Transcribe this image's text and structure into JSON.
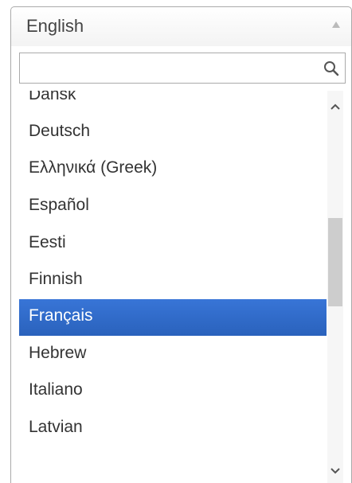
{
  "select": {
    "selected_value": "English"
  },
  "search": {
    "value": "",
    "placeholder": ""
  },
  "options": [
    {
      "label": "Dansk",
      "highlighted": false
    },
    {
      "label": "Deutsch",
      "highlighted": false
    },
    {
      "label": "Ελληνικά (Greek)",
      "highlighted": false
    },
    {
      "label": "Español",
      "highlighted": false
    },
    {
      "label": "Eesti",
      "highlighted": false
    },
    {
      "label": "Finnish",
      "highlighted": false
    },
    {
      "label": "Français",
      "highlighted": true
    },
    {
      "label": "Hebrew",
      "highlighted": false
    },
    {
      "label": "Italiano",
      "highlighted": false
    },
    {
      "label": "Latvian",
      "highlighted": false
    }
  ],
  "colors": {
    "highlight": "#3875d7",
    "border": "#aaaaaa",
    "scroll_thumb": "#cdcdcd"
  },
  "icons": {
    "search": "search-icon",
    "select_arrow": "triangle-up-icon",
    "scroll_up": "chevron-up-icon",
    "scroll_down": "chevron-down-icon"
  }
}
